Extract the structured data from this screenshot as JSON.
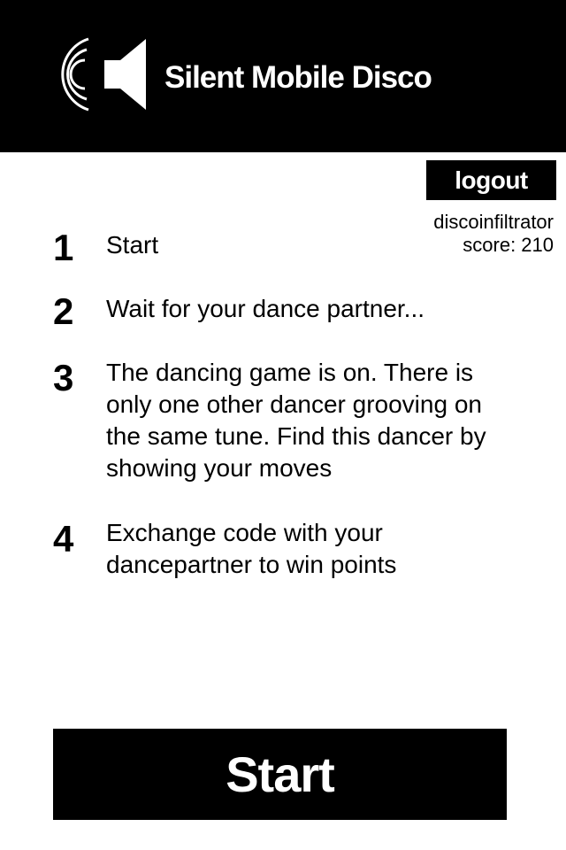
{
  "header": {
    "title": "Silent Mobile Disco",
    "logo_icon": "speaker-sound-icon"
  },
  "user": {
    "logout_label": "logout",
    "username": "discoinfiltrator",
    "score_text": "score: 210"
  },
  "steps": [
    {
      "number": "1",
      "text": "Start"
    },
    {
      "number": "2",
      "text": "Wait for your dance partner..."
    },
    {
      "number": "3",
      "text": "The dancing game is on. There is only one other dancer grooving on the same tune. Find this dancer by showing your moves"
    },
    {
      "number": "4",
      "text": "Exchange code with your dancepartner to win points"
    }
  ],
  "start_button": {
    "label": "Start"
  },
  "colors": {
    "primary": "#000000",
    "background": "#ffffff",
    "text_on_primary": "#ffffff"
  }
}
